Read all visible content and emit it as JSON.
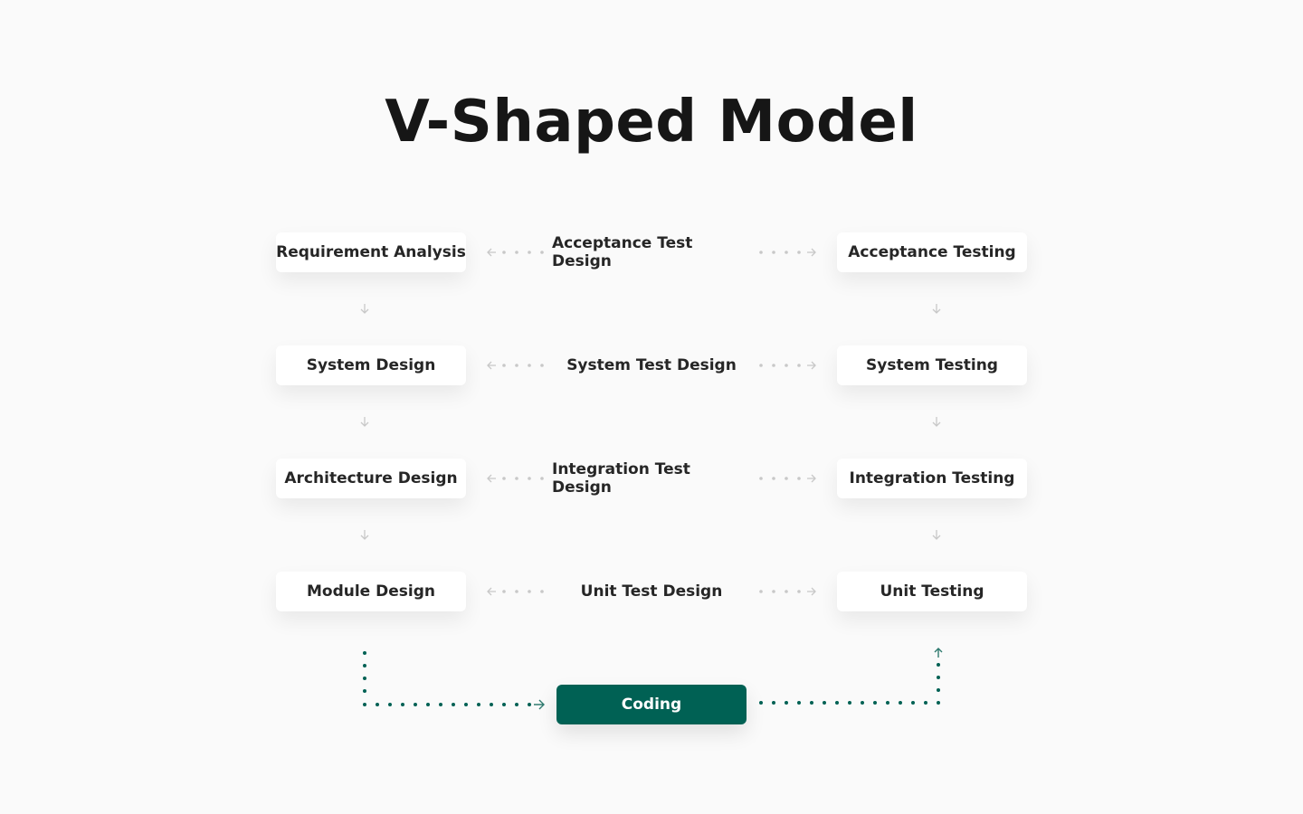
{
  "title": "V-Shaped Model",
  "rows": [
    {
      "left": "Requirement Analysis",
      "middle": "Acceptance Test Design",
      "right": "Acceptance Testing"
    },
    {
      "left": "System Design",
      "middle": "System Test Design",
      "right": "System Testing"
    },
    {
      "left": "Architecture Design",
      "middle": "Integration Test Design",
      "right": "Integration Testing"
    },
    {
      "left": "Module Design",
      "middle": "Unit Test Design",
      "right": "Unit Testing"
    }
  ],
  "bottom": {
    "label": "Coding"
  },
  "colors": {
    "accent": "#006154",
    "connector": "#c8c8c8",
    "background": "#fafafa"
  }
}
